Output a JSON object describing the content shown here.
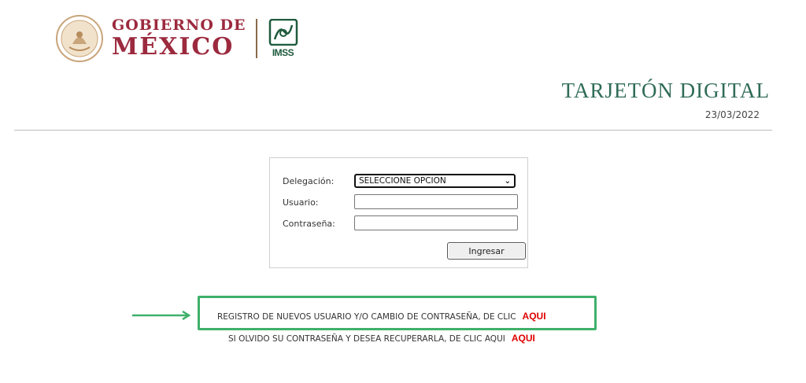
{
  "header": {
    "gobierno_line1": "GOBIERNO DE",
    "gobierno_line2": "MÉXICO",
    "imss_label": "IMSS"
  },
  "page": {
    "title": "TARJETÓN DIGITAL",
    "date": "23/03/2022"
  },
  "login": {
    "delegacion_label": "Delegación:",
    "delegacion_selected": "SELECCIONE OPCION",
    "usuario_label": "Usuario:",
    "usuario_value": "",
    "contrasena_label": "Contraseña:",
    "contrasena_value": "",
    "submit_label": "Ingresar"
  },
  "links": {
    "registro_text": "REGISTRO DE NUEVOS USUARIO Y/O CAMBIO DE CONTRASEÑA, DE CLIC",
    "registro_link": "AQUI",
    "recuperar_text": "SI OLVIDO SU CONTRASEÑA Y DESEA RECUPERARLA, DE CLIC AQUI",
    "recuperar_link": "AQUI"
  },
  "colors": {
    "brand_red": "#9c2a3e",
    "title_green": "#2f6b57",
    "highlight_green": "#3fb06a",
    "link_red": "#e00000"
  }
}
